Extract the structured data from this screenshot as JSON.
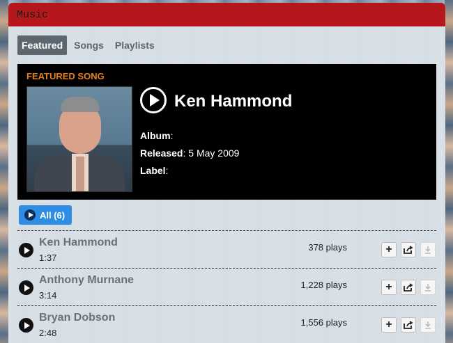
{
  "window": {
    "title": "Music"
  },
  "tabs": [
    {
      "label": "Featured",
      "active": true
    },
    {
      "label": "Songs",
      "active": false
    },
    {
      "label": "Playlists",
      "active": false
    }
  ],
  "featured": {
    "section_label": "FEATURED SONG",
    "song_title": "Ken Hammond",
    "album_label": "Album",
    "album_value": "",
    "released_label": "Released",
    "released_value": "5 May 2009",
    "label_label": "Label",
    "label_value": ""
  },
  "filter": {
    "label": "All (6)"
  },
  "tracks": [
    {
      "title": "Ken Hammond",
      "duration": "1:37",
      "plays": "378 plays"
    },
    {
      "title": "Anthony Murnane",
      "duration": "3:14",
      "plays": "1,228 plays"
    },
    {
      "title": "Bryan Dobson",
      "duration": "2:48",
      "plays": "1,556 plays"
    }
  ],
  "icons": {
    "add": "+",
    "share": "share-icon",
    "download": "download-icon"
  },
  "colors": {
    "titlebar": "#b5171c",
    "featured_label": "#e8801a",
    "all_button": "#2f8ee4"
  }
}
